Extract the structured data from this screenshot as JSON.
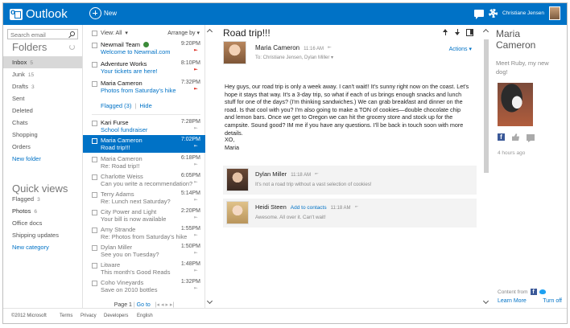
{
  "app": {
    "name": "Outlook",
    "new_label": "New",
    "user_name": "Christiane Jensen"
  },
  "nav": {
    "search_placeholder": "Search email",
    "folders_title": "Folders",
    "folders": [
      {
        "label": "Inbox",
        "count": "5"
      },
      {
        "label": "Junk",
        "count": "15"
      },
      {
        "label": "Drafts",
        "count": "3"
      },
      {
        "label": "Sent",
        "count": ""
      },
      {
        "label": "Deleted",
        "count": ""
      },
      {
        "label": "Chats",
        "count": ""
      },
      {
        "label": "Shopping",
        "count": ""
      },
      {
        "label": "Orders",
        "count": ""
      }
    ],
    "new_folder": "New folder",
    "quick_views_title": "Quick views",
    "quick_views": [
      {
        "label": "Flagged",
        "count": "3"
      },
      {
        "label": "Photos",
        "count": "6"
      },
      {
        "label": "Office docs",
        "count": ""
      },
      {
        "label": "Shipping updates",
        "count": ""
      }
    ],
    "new_category": "New category"
  },
  "list": {
    "view_label": "View: All",
    "arrange_label": "Arrange by",
    "messages": [
      {
        "from": "Newmail Team",
        "time": "9:20PM",
        "subject": "Welcome to Newmail.com"
      },
      {
        "from": "Adventure Works",
        "time": "8:10PM",
        "subject": "Your tickets are here!"
      },
      {
        "from": "Maria Cameron",
        "time": "7:32PM",
        "subject": "Photos from Saturday's hike"
      },
      {
        "from": "Kari Furse",
        "time": "7:28PM",
        "subject": "School fundraiser"
      },
      {
        "from": "Maria Cameron",
        "time": "7:02PM",
        "subject": "Road trip!!!"
      },
      {
        "from": "Maria Cameron",
        "time": "6:18PM",
        "subject": "Re: Road trip!!"
      },
      {
        "from": "Charlotte Weiss",
        "time": "6:05PM",
        "subject": "Can you write a recommendation?"
      },
      {
        "from": "Terry Adams",
        "time": "5:14PM",
        "subject": "Re: Lunch next Saturday?"
      },
      {
        "from": "City Power and Light",
        "time": "2:20PM",
        "subject": "Your bill is now available"
      },
      {
        "from": "Amy Strande",
        "time": "1:55PM",
        "subject": "Re: Photos from Saturday's hike"
      },
      {
        "from": "Dylan Miller",
        "time": "1:50PM",
        "subject": "See you on Tuesday?"
      },
      {
        "from": "Litware",
        "time": "1:48PM",
        "subject": "This month's Good Reads"
      },
      {
        "from": "Coho Vineyards",
        "time": "1:32PM",
        "subject": "Save on 2010 bottles"
      }
    ],
    "flagged_label": "Flagged (3)",
    "hide_label": "Hide",
    "page_label": "Page 1",
    "goto_label": "Go to",
    "pager_glyphs": "|◂ ◂ ▸ ▸|"
  },
  "reading": {
    "subject": "Road trip!!!",
    "sender": "Maria Cameron",
    "sent_time": "11:16 AM",
    "to_line": "To: Christiane Jensen, Dylan Miller",
    "actions_label": "Actions",
    "body": "Hey guys, our road trip is only a week away. I can't wait!! It's sunny right now on the coast. Let's hope it stays that way. It's a 3-day trip, so what if each of us brings enough snacks and lunch stuff for one of the days? (I'm thinking sandwiches.) We can grab breakfast and dinner on the road. Is that cool with you? I'm also going to make a TON of cookies—double chocolate chip and lemon bars. Once we get to Oregon we can hit the grocery store and stock up for the campsite. Sound good? IM me if you have any questions. I'll be back in touch soon with more details.",
    "signoff": "XO,",
    "signature": "Maria",
    "replies": [
      {
        "name": "Dylan Miller",
        "add": "",
        "time": "11:18 AM",
        "text": "It's not a road trip without a vast selection of cookies!"
      },
      {
        "name": "Heidi Steen",
        "add": "Add to contacts",
        "time": "11:18 AM",
        "text": "Awesome. All over it.  Can't wait!"
      }
    ]
  },
  "people": {
    "first_name": "Maria",
    "last_name": "Cameron",
    "status": "Meet Ruby, my new dog!",
    "ago": "4 hours ago",
    "content_from": "Content from",
    "learn_more": "Learn More",
    "turn_off": "Turn off"
  },
  "footer": {
    "copyright": "©2012 Microsoft",
    "links": [
      "Terms",
      "Privacy",
      "Developers",
      "English"
    ]
  }
}
